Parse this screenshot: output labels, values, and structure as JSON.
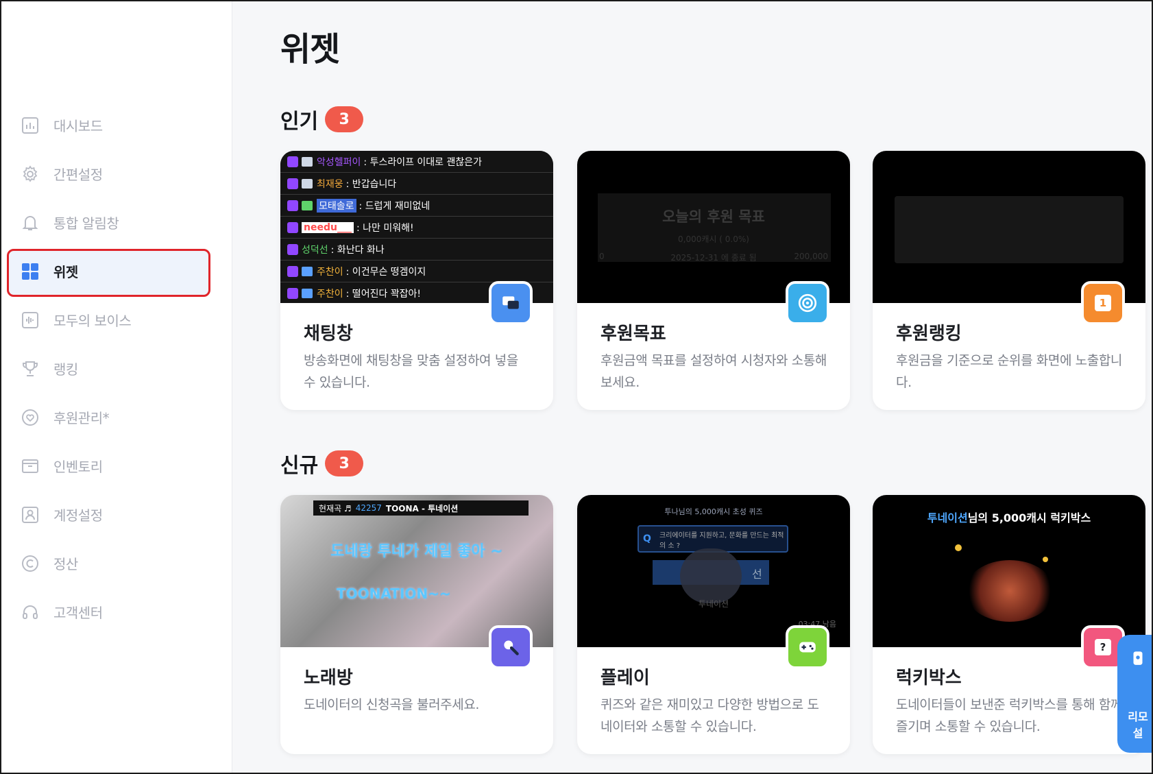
{
  "sidebar": {
    "items": [
      {
        "key": "dashboard",
        "label": "대시보드",
        "icon": "chart-icon"
      },
      {
        "key": "quick",
        "label": "간편설정",
        "icon": "gear-icon"
      },
      {
        "key": "alert",
        "label": "통합 알림창",
        "icon": "bell-icon"
      },
      {
        "key": "widget",
        "label": "위젯",
        "icon": "grid-icon",
        "active": true
      },
      {
        "key": "voice",
        "label": "모두의 보이스",
        "icon": "waveform-icon"
      },
      {
        "key": "ranking",
        "label": "랭킹",
        "icon": "trophy-icon"
      },
      {
        "key": "donation",
        "label": "후원관리*",
        "icon": "heart-icon"
      },
      {
        "key": "inventory",
        "label": "인벤토리",
        "icon": "box-icon"
      },
      {
        "key": "account",
        "label": "계정설정",
        "icon": "person-icon"
      },
      {
        "key": "settle",
        "label": "정산",
        "icon": "copyright-icon"
      },
      {
        "key": "support",
        "label": "고객센터",
        "icon": "headset-icon"
      }
    ]
  },
  "main": {
    "title": "위젯",
    "sections": [
      {
        "title": "인기",
        "count": "3",
        "cards": [
          {
            "name": "채팅창",
            "desc": "방송화면에 채팅창을 맞춤 설정하여 넣을 수 있습니다.",
            "icon": "chat-icon",
            "color": "#4a90f0"
          },
          {
            "name": "후원목표",
            "desc": "후원금액 목표를 설정하여 시청자와 소통해 보세요.",
            "icon": "target-icon",
            "color": "#3aaeea"
          },
          {
            "name": "후원랭킹",
            "desc": "후원금을 기준으로 순위를 화면에 노출합니다.",
            "icon": "rank-one-icon",
            "color": "#f58b2e",
            "icon_text": "1"
          }
        ]
      },
      {
        "title": "신규",
        "count": "3",
        "cards": [
          {
            "name": "노래방",
            "desc": "도네이터의 신청곡을 불러주세요.",
            "icon": "microphone-icon",
            "color": "#6c63e8"
          },
          {
            "name": "플레이",
            "desc": "퀴즈와 같은 재미있고 다양한 방법으로 도네이터와 소통할 수 있습니다.",
            "icon": "gamepad-icon",
            "color": "#7ed43a"
          },
          {
            "name": "럭키박스",
            "desc": "도네이터들이 보낸준 럭키박스를 통해 함께 즐기며 소통할 수 있습니다.",
            "icon": "question-icon",
            "color": "#f2577e",
            "icon_text": "?"
          }
        ]
      }
    ]
  },
  "chat_preview": [
    {
      "name": "악성헬퍼이",
      "color": "#a657ff",
      "msg": ": 투스라이프 이대로 괜찮은가"
    },
    {
      "name": "최재웅",
      "color": "#f2a93b",
      "msg": ": 반갑습니다"
    },
    {
      "name": "모태솔로",
      "color": "#7fb0ff",
      "msg": ": 드럽게 재미없네"
    },
    {
      "name": "needu___",
      "color": "#ff4b4b",
      "msg": ": 나만 미워해!"
    },
    {
      "name": "성덕선",
      "color": "#5fd36b",
      "msg": ": 화난다 화나"
    },
    {
      "name": "주찬이",
      "color": "#f2b33b",
      "msg": ": 이건무슨 떵겜이지"
    },
    {
      "name": "주찬이",
      "color": "#f2b33b",
      "msg": ": 떨어진다 꽉잡아!"
    }
  ],
  "goal_preview": {
    "title": "오늘의 후원 목표",
    "amount": "0,000캐시 ( 0.0%)",
    "min": "0",
    "end": "2025-12-31 에 종료 됨",
    "max": "200,000"
  },
  "karaoke_preview": {
    "now": "현재곡 ♬",
    "number": "42257",
    "song": "TOONA - 투네이션",
    "line1": "도네랑 투네가 제일 좋아 ~",
    "line2": "TOONATION~~"
  },
  "play_preview": {
    "header": "투나님의 5,000캐시 초성 퀴즈",
    "question_icon": "Q",
    "question": "크리에이터를 지원하고, 문화를 만드는 최적의 소 ?",
    "answer_right": "선",
    "footer": "투네이션",
    "timer": "03:47 남음"
  },
  "lucky_preview": {
    "donor": "투네이션",
    "text": "님의 5,000캐시 럭키박스"
  },
  "remote": {
    "line1": "리모",
    "line2": "설"
  }
}
